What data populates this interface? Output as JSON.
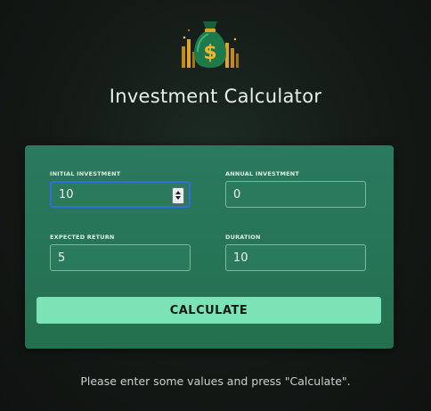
{
  "header": {
    "logo_icon": "money-bag-icon",
    "title": "Investment Calculator"
  },
  "form": {
    "initial_investment": {
      "label": "Initial Investment",
      "value": "10"
    },
    "annual_investment": {
      "label": "Annual Investment",
      "value": "0"
    },
    "expected_return": {
      "label": "Expected Return",
      "value": "5"
    },
    "duration": {
      "label": "Duration",
      "value": "10"
    },
    "calculate_label": "CALCULATE"
  },
  "status": {
    "message": "Please enter some values and press \"Calculate\"."
  },
  "colors": {
    "card": "#2a7a60",
    "button": "#7ce3b6",
    "focus": "#2e6fd8",
    "logo_green": "#1e7a4a",
    "logo_gold": "#e0a322"
  }
}
